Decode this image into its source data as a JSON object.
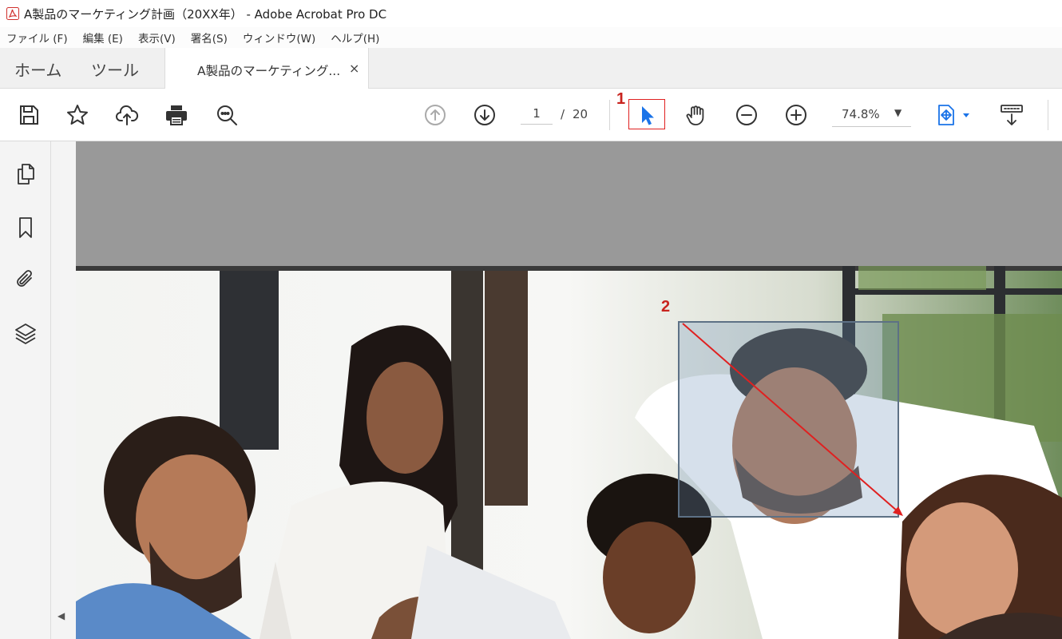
{
  "window": {
    "title": "A製品のマーケティング計画（20XX年） - Adobe Acrobat Pro DC"
  },
  "menu": [
    {
      "label": "ファイル (F)"
    },
    {
      "label": "編集 (E)"
    },
    {
      "label": "表示(V)"
    },
    {
      "label": "署名(S)"
    },
    {
      "label": "ウィンドウ(W)"
    },
    {
      "label": "ヘルプ(H)"
    }
  ],
  "tabs": {
    "home": "ホーム",
    "tools": "ツール",
    "document": "A製品のマーケティング...",
    "close": "×"
  },
  "toolbar": {
    "page_current": "1",
    "page_separator": "/",
    "page_total": "20",
    "zoom": "74.8%",
    "zoom_caret": "▼",
    "icons": [
      "save-icon",
      "star-icon",
      "cloud-upload-icon",
      "print-icon",
      "zoom-search-icon",
      "page-up-icon",
      "page-down-icon",
      "select-cursor-icon",
      "hand-tool-icon",
      "zoom-out-icon",
      "zoom-in-icon",
      "fit-page-icon",
      "scroll-mode-icon"
    ]
  },
  "side_panel": {
    "icons": [
      "page-thumbnails-icon",
      "bookmark-icon",
      "attachment-icon",
      "layers-icon"
    ],
    "collapse": "◀"
  },
  "annotations": {
    "step1": "1",
    "step2": "2",
    "color": "#c8231e"
  },
  "colors": {
    "accent_blue": "#1a73e8",
    "highlight_red": "#e02020",
    "page_gray": "#999999"
  }
}
